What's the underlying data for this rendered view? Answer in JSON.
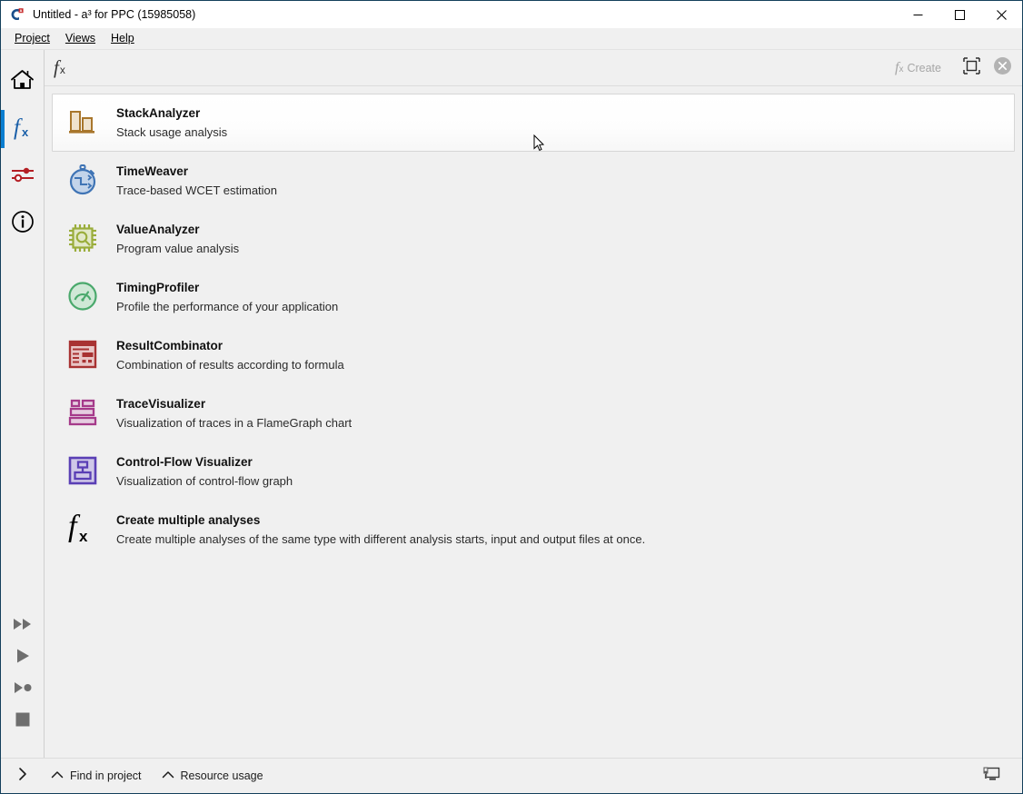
{
  "window": {
    "title": "Untitled - a³ for PPC (15985058)",
    "app_icon": "a3-app-icon",
    "controls": {
      "minimize": "minimize",
      "maximize": "maximize",
      "close": "close"
    }
  },
  "menubar": {
    "items": [
      {
        "label": "Project",
        "mnemonic": "P"
      },
      {
        "label": "Views",
        "mnemonic": "V"
      },
      {
        "label": "Help",
        "mnemonic": "H"
      }
    ]
  },
  "rail": {
    "top_items": [
      {
        "name": "home",
        "icon": "home-icon",
        "active": false
      },
      {
        "name": "analyses",
        "icon": "fx-icon",
        "active": true
      },
      {
        "name": "settings",
        "icon": "sliders-icon",
        "active": false
      },
      {
        "name": "info",
        "icon": "info-icon",
        "active": false
      }
    ],
    "bottom_items": [
      {
        "name": "run-all",
        "icon": "fast-forward-icon"
      },
      {
        "name": "run",
        "icon": "play-icon"
      },
      {
        "name": "run-to-point",
        "icon": "play-to-point-icon"
      },
      {
        "name": "stop",
        "icon": "stop-icon"
      }
    ]
  },
  "toolbar": {
    "fx_label": "f",
    "fx_sub": "x",
    "create_label": "Create",
    "maximize_panel_icon": "maximize-panel-icon",
    "close_panel_icon": "close-circle-icon"
  },
  "analyses": [
    {
      "title": "StackAnalyzer",
      "description": "Stack usage analysis",
      "icon": "stack-analyzer-icon",
      "color": "#a8762c",
      "selected": true
    },
    {
      "title": "TimeWeaver",
      "description": "Trace-based WCET estimation",
      "icon": "time-weaver-icon",
      "color": "#3f74b5",
      "selected": false
    },
    {
      "title": "ValueAnalyzer",
      "description": "Program value analysis",
      "icon": "value-analyzer-icon",
      "color": "#9aad3b",
      "selected": false
    },
    {
      "title": "TimingProfiler",
      "description": "Profile the performance of your application",
      "icon": "timing-profiler-icon",
      "color": "#4aa96c",
      "selected": false
    },
    {
      "title": "ResultCombinator",
      "description": "Combination of results according to formula",
      "icon": "result-combinator-icon",
      "color": "#a83232",
      "selected": false
    },
    {
      "title": "TraceVisualizer",
      "description": "Visualization of traces in a FlameGraph chart",
      "icon": "trace-visualizer-icon",
      "color": "#a53a8a",
      "selected": false
    },
    {
      "title": "Control-Flow Visualizer",
      "description": "Visualization of control-flow graph",
      "icon": "control-flow-visualizer-icon",
      "color": "#5a3fb5",
      "selected": false
    },
    {
      "title": "Create multiple analyses",
      "description": "Create multiple analyses of the same type with different analysis starts, input and output files at once.",
      "icon": "fx-large-icon",
      "color": "#000000",
      "selected": false
    }
  ],
  "statusbar": {
    "expand_icon": "chevron-right-icon",
    "items": [
      {
        "label": "Find in project",
        "icon": "chevron-up-icon"
      },
      {
        "label": "Resource usage",
        "icon": "chevron-up-icon"
      }
    ],
    "display_icon": "monitor-icon"
  }
}
